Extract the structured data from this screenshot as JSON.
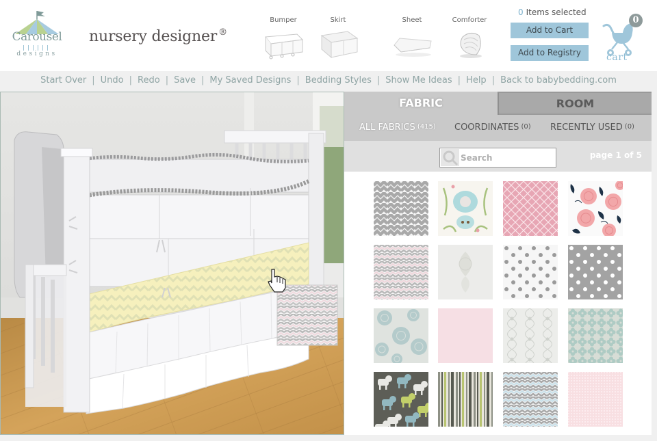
{
  "brand": {
    "logo_text": "Carousel",
    "logo_subtext": "designs",
    "app_title": "nursery designer",
    "registered_mark": "®"
  },
  "products": [
    {
      "label": "Bumper",
      "icon": "bumper-icon"
    },
    {
      "label": "Skirt",
      "icon": "skirt-icon"
    },
    {
      "label": "Sheet",
      "icon": "sheet-icon"
    },
    {
      "label": "Comforter",
      "icon": "comforter-icon"
    }
  ],
  "selection": {
    "count": "0",
    "label": "Items selected"
  },
  "buttons": {
    "add_to_cart": "Add to Cart",
    "add_to_registry": "Add to Registry"
  },
  "cart": {
    "badge": "0",
    "label": "cart"
  },
  "nav": [
    "Start Over",
    "Undo",
    "Redo",
    "Save",
    "My Saved Designs",
    "Bedding Styles",
    "Show Me Ideas",
    "Help",
    "Back to babybedding.com"
  ],
  "panel": {
    "tabs": {
      "fabric": "FABRIC",
      "room": "ROOM",
      "active": "FABRIC"
    },
    "subtabs": [
      {
        "label": "ALL FABRICS",
        "count": "(415)",
        "active": true
      },
      {
        "label": "COORDINATES",
        "count": "(0)",
        "active": false
      },
      {
        "label": "RECENTLY USED",
        "count": "(0)",
        "active": false
      }
    ],
    "search": {
      "placeholder": "Search",
      "value": ""
    },
    "pagination": {
      "prefix": "page",
      "current": "1",
      "of": "of",
      "total": "5"
    }
  },
  "swatches": [
    {
      "name": "gray-chevron",
      "pattern": "chevron",
      "colors": [
        "#a9a9a9",
        "#f4f4f4"
      ]
    },
    {
      "name": "aqua-green-damask",
      "pattern": "damask",
      "colors": [
        "#f7f5ef",
        "#8ecfd6",
        "#a8c27e",
        "#e9a0a8"
      ]
    },
    {
      "name": "pink-lattice",
      "pattern": "lattice",
      "colors": [
        "#e7a6b4",
        "#fbe6ea"
      ]
    },
    {
      "name": "pink-navy-floral",
      "pattern": "floral",
      "colors": [
        "#fafafa",
        "#f2a7a9",
        "#1e3247"
      ]
    },
    {
      "name": "pink-gray-chevron",
      "pattern": "chevron3",
      "colors": [
        "#b8b8b8",
        "#f4f4f4",
        "#efd7dc"
      ]
    },
    {
      "name": "white-damask",
      "pattern": "subtle-damask",
      "colors": [
        "#ececea",
        "#dedfd9"
      ]
    },
    {
      "name": "gray-dot-on-white",
      "pattern": "dots",
      "colors": [
        "#f6f6f6",
        "#9a9a9a"
      ]
    },
    {
      "name": "white-dot-on-gray",
      "pattern": "dots",
      "colors": [
        "#a3a3a3",
        "#ffffff"
      ]
    },
    {
      "name": "aqua-dahlia",
      "pattern": "floral-soft",
      "colors": [
        "#dfe3df",
        "#a9c4c6"
      ]
    },
    {
      "name": "pink-solid",
      "pattern": "solid",
      "colors": [
        "#f6dfe4"
      ]
    },
    {
      "name": "white-trellis",
      "pattern": "trellis",
      "colors": [
        "#ecedea",
        "#cfd2cd"
      ]
    },
    {
      "name": "aqua-quatrefoil",
      "pattern": "quatrefoil",
      "colors": [
        "#d7ddd6",
        "#aecbc4"
      ]
    },
    {
      "name": "dog-print",
      "pattern": "dogs",
      "colors": [
        "#5d5e57",
        "#92b8c0",
        "#c2cf6a",
        "#e8e8e4"
      ]
    },
    {
      "name": "green-stripe",
      "pattern": "stripes",
      "colors": [
        "#8e9186",
        "#e8e6dc",
        "#b8c470",
        "#575a50"
      ]
    },
    {
      "name": "blue-gray-chevron",
      "pattern": "chevron3",
      "colors": [
        "#a8a8a8",
        "#f2f2f2",
        "#c9e1ea"
      ]
    },
    {
      "name": "pink-dot-texture",
      "pattern": "texture",
      "colors": [
        "#f8dfe2",
        "#fcecef"
      ]
    }
  ],
  "preview": {
    "selected_fabric": "pink-gray-chevron",
    "skirt_fabric": "yellow-chevron",
    "bedding_base_color": "#f5f5f7",
    "skirt_color": "#f6f0bd",
    "floor_color": "#c8954c"
  },
  "colors": {
    "accent_button": "#9fc6da",
    "nav_text": "#8fa4a4",
    "panel_tab_active": "#c9c9c9",
    "panel_tab_inactive": "#a9a9a9"
  }
}
